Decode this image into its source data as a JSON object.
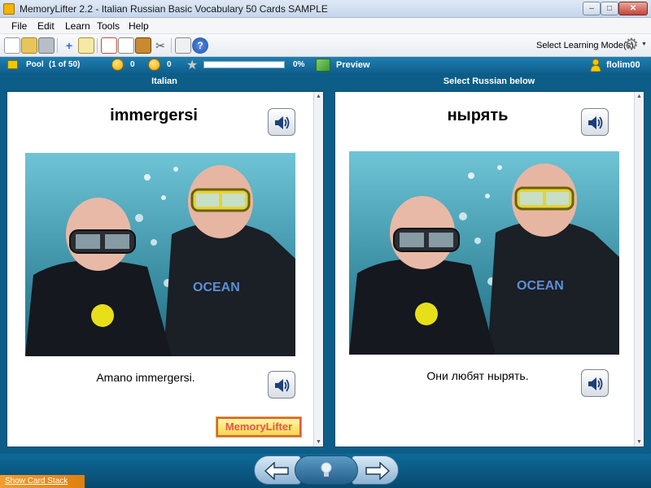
{
  "window": {
    "title": "MemoryLifter 2.2 - Italian Russian Basic Vocabulary 50 Cards SAMPLE",
    "minimize_label": "–",
    "maximize_label": "□",
    "close_label": "✕"
  },
  "menu": {
    "items": [
      {
        "label": "File"
      },
      {
        "label": "Edit"
      },
      {
        "label": "Learn"
      },
      {
        "label": "Tools"
      },
      {
        "label": "Help"
      }
    ]
  },
  "toolbar": {
    "icons": [
      "new-file-icon",
      "open-folder-icon",
      "print-icon",
      "add-card-icon",
      "edit-card-icon",
      "slideshow-icon",
      "print-cards-icon",
      "statistics-icon",
      "tools-icon",
      "lock-icon",
      "help-icon"
    ],
    "mode_label": "Select Learning Mode(s)"
  },
  "status": {
    "pool_label": "Pool",
    "pool_count": "(1 of 50)",
    "correct_score": "0",
    "wrong_score": "0",
    "progress_value": 0,
    "progress_text": "0%",
    "preview_label": "Preview",
    "username": "flolim00"
  },
  "question": {
    "header": "Italian",
    "word": "immergersi",
    "sentence": "Amano immergersi."
  },
  "answer": {
    "header": "Select Russian below",
    "word": "нырять",
    "sentence": "Они любят нырять."
  },
  "branding": {
    "logo_text": "MemoryLifter"
  },
  "footer": {
    "show_stack_label": "Show Card Stack"
  },
  "colors": {
    "main_bg": "#0c5d87",
    "status_bar": "#1f7fb0",
    "stack_tab": "#f39c2e",
    "logo_border": "#e2574f"
  }
}
